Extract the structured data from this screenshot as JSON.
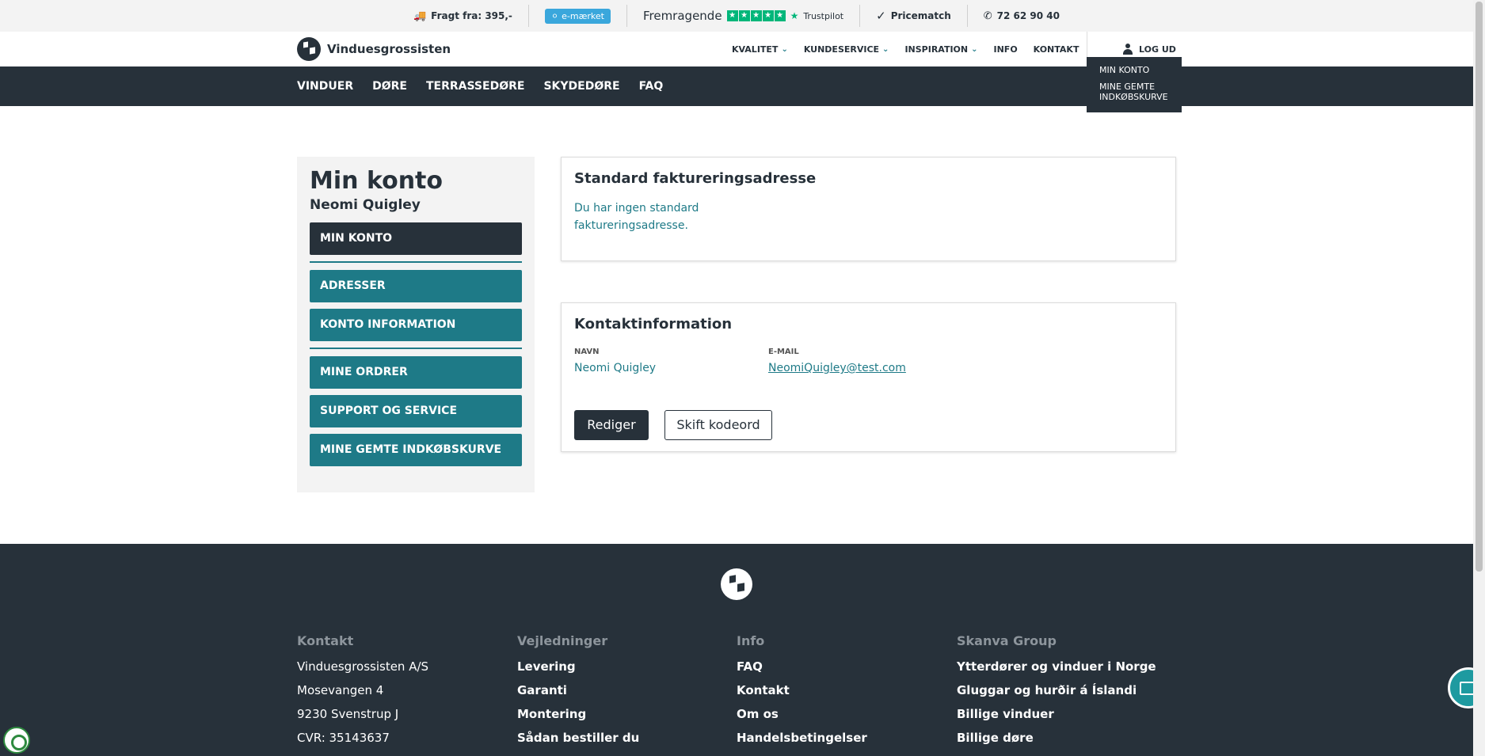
{
  "topbar": {
    "freight": "Fragt fra: 395,-",
    "emaerke": "e-mærket",
    "rating_word": "Fremragende",
    "trustpilot": "Trustpilot",
    "pricematch": "Pricematch",
    "phone": "72 62 90 40"
  },
  "header": {
    "logo_text": "Vinduesgrossisten",
    "nav": [
      "KVALITET",
      "KUNDESERVICE",
      "INSPIRATION",
      "INFO",
      "KONTAKT"
    ],
    "logout": "LOG UD"
  },
  "dropdown": {
    "items": [
      "MIN KONTO",
      "MINE GEMTE INDKØBSKURVE"
    ]
  },
  "categories": [
    "VINDUER",
    "DØRE",
    "TERRASSEDØRE",
    "SKYDEDØRE",
    "FAQ"
  ],
  "sidebar": {
    "title": "Min konto",
    "user": "Neomi Quigley",
    "items": [
      "MIN KONTO",
      "ADRESSER",
      "KONTO INFORMATION",
      "MINE ORDRER",
      "SUPPORT OG SERVICE",
      "MINE GEMTE INDKØBSKURVE"
    ]
  },
  "billing": {
    "title": "Standard faktureringsadresse",
    "message_line1": "Du har ingen standard",
    "message_line2": "faktureringsadresse."
  },
  "contact": {
    "title": "Kontaktinformation",
    "name_label": "NAVN",
    "name_value": "Neomi Quigley",
    "email_label": "E-MAIL",
    "email_value": "NeomiQuigley@test.com",
    "edit_button": "Rediger",
    "password_button": "Skift kodeord"
  },
  "footer": {
    "columns": [
      {
        "heading": "Kontakt",
        "items": [
          "Vinduesgrossisten A/S",
          "Mosevangen 4",
          "9230 Svenstrup J",
          "CVR: 35143637"
        ]
      },
      {
        "heading": "Vejledninger",
        "items": [
          "Levering",
          "Garanti",
          "Montering",
          "Sådan bestiller du"
        ]
      },
      {
        "heading": "Info",
        "items": [
          "FAQ",
          "Kontakt",
          "Om os",
          "Handelsbetingelser"
        ]
      },
      {
        "heading": "Skanva Group",
        "items": [
          "Ytterdører og vinduer i Norge",
          "Gluggar og hurðir á Íslandi",
          "Billige vinduer",
          "Billige døre"
        ]
      }
    ]
  },
  "colors": {
    "dark": "#27313a",
    "teal": "#1e7a87",
    "trustpilot_green": "#00b67a",
    "emaerke_blue": "#3aa7dc"
  }
}
